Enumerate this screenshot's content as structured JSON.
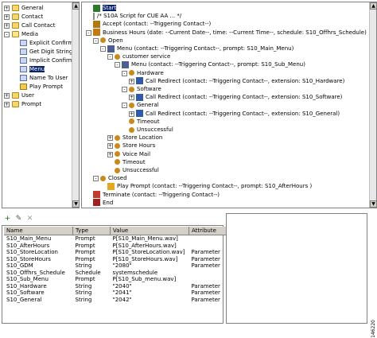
{
  "palette": {
    "tree": [
      {
        "label": "General",
        "icon": "folder-icon",
        "indent": 0,
        "expander": "+"
      },
      {
        "label": "Contact",
        "icon": "folder-icon",
        "indent": 0,
        "expander": "+"
      },
      {
        "label": "Call Contact",
        "icon": "folder-icon",
        "indent": 0,
        "expander": "+"
      },
      {
        "label": "Media",
        "icon": "folder-open-icon",
        "indent": 0,
        "expander": "-"
      },
      {
        "label": "Explicit Confirmation",
        "icon": "step-icon",
        "indent": 1
      },
      {
        "label": "Get Digit String",
        "icon": "step-icon",
        "indent": 1
      },
      {
        "label": "Implicit Confirmation",
        "icon": "step-icon",
        "indent": 1
      },
      {
        "label": "Menu",
        "icon": "menu-step-icon",
        "indent": 1,
        "selected": true
      },
      {
        "label": "Name To User",
        "icon": "step-icon",
        "indent": 1
      },
      {
        "label": "Play Prompt",
        "icon": "speaker-icon",
        "indent": 1
      },
      {
        "label": "User",
        "icon": "folder-icon",
        "indent": 0,
        "expander": "+"
      },
      {
        "label": "Prompt",
        "icon": "folder-icon",
        "indent": 0,
        "expander": "+"
      }
    ]
  },
  "script": {
    "lines": [
      {
        "text": "Start",
        "indent": 0,
        "icon": "start-icon",
        "selected": true
      },
      {
        "text": "/* S10A Script for CUE AA ... */",
        "indent": 0,
        "icon": "comment-icon"
      },
      {
        "text": "Accept (contact: --Triggering Contact--)",
        "indent": 0,
        "icon": "accept-icon"
      },
      {
        "text": "Business Hours (date: --Current Date--, time: --Current Time--, schedule: S10_Offhrs_Schedule)",
        "indent": 0,
        "icon": "clock-icon",
        "expander": "-"
      },
      {
        "text": "Open",
        "indent": 1,
        "icon": "branch-icon",
        "expander": "-"
      },
      {
        "text": "Menu (contact: --Triggering Contact--, prompt: S10_Main_Menu)",
        "indent": 2,
        "icon": "menu-icon",
        "expander": "-"
      },
      {
        "text": "customer service",
        "indent": 3,
        "icon": "branch-icon",
        "expander": "-"
      },
      {
        "text": "Menu (contact: --Triggering Contact--, prompt: S10_Sub_Menu)",
        "indent": 4,
        "icon": "menu-icon",
        "expander": "-"
      },
      {
        "text": "Hardware",
        "indent": 5,
        "icon": "branch-icon",
        "expander": "-"
      },
      {
        "text": "Call Redirect (contact: --Triggering Contact--, extension: S10_Hardware)",
        "indent": 6,
        "icon": "redirect-icon",
        "expander": "+"
      },
      {
        "text": "Software",
        "indent": 5,
        "icon": "branch-icon",
        "expander": "-"
      },
      {
        "text": "Call Redirect (contact: --Triggering Contact--, extension: S10_Software)",
        "indent": 6,
        "icon": "redirect-icon",
        "expander": "+"
      },
      {
        "text": "General",
        "indent": 5,
        "icon": "branch-icon",
        "expander": "-"
      },
      {
        "text": "Call Redirect (contact: --Triggering Contact--, extension: S10_General)",
        "indent": 6,
        "icon": "redirect-icon",
        "expander": "+"
      },
      {
        "text": "Timeout",
        "indent": 5,
        "icon": "branch-icon"
      },
      {
        "text": "Unsuccessful",
        "indent": 5,
        "icon": "branch-icon"
      },
      {
        "text": "Store Location",
        "indent": 3,
        "icon": "branch-icon",
        "expander": "+"
      },
      {
        "text": "Store Hours",
        "indent": 3,
        "icon": "branch-icon",
        "expander": "+"
      },
      {
        "text": "Voice Mail",
        "indent": 3,
        "icon": "branch-icon",
        "expander": "+"
      },
      {
        "text": "Timeout",
        "indent": 3,
        "icon": "branch-icon"
      },
      {
        "text": "Unsuccessful",
        "indent": 3,
        "icon": "branch-icon"
      },
      {
        "text": "Closed",
        "indent": 1,
        "icon": "branch-icon",
        "expander": "-"
      },
      {
        "text": "Play Prompt (contact: --Triggering Contact--, prompt: S10_AfterHours )",
        "indent": 2,
        "icon": "speaker-icon"
      },
      {
        "text": "Terminate (contact: --Triggering Contact--)",
        "indent": 0,
        "icon": "terminate-icon"
      },
      {
        "text": "End",
        "indent": 0,
        "icon": "end-icon"
      }
    ]
  },
  "variables": {
    "toolbar": {
      "add": "+",
      "edit": "✎",
      "delete": "✕"
    },
    "columns": [
      "Name",
      "Type",
      "Value",
      "Attribute"
    ],
    "rows": [
      [
        "S10_Main_Menu",
        "Prompt",
        "P[S10_Main_Menu.wav]",
        ""
      ],
      [
        "S10_AfterHours",
        "Prompt",
        "P[S10_AfterHours.wav]",
        ""
      ],
      [
        "S10_StoreLocation",
        "Prompt",
        "P[S10_StoreLocation.wav]",
        "Parameter"
      ],
      [
        "S10_StoreHours",
        "Prompt",
        "P[S10_StoreHours.wav]",
        "Parameter"
      ],
      [
        "S10_GDM",
        "String",
        "\"2080\"",
        "Parameter"
      ],
      [
        "S10_Offhrs_Schedule",
        "Schedule",
        "systemschedule",
        ""
      ],
      [
        "S10_Sub_Menu",
        "Prompt",
        "P[S10_Sub_menu.wav]",
        ""
      ],
      [
        "S10_Hardware",
        "String",
        "\"2040\"",
        "Parameter"
      ],
      [
        "S10_Software",
        "String",
        "\"2041\"",
        "Parameter"
      ],
      [
        "S10_General",
        "String",
        "\"2042\"",
        "Parameter"
      ]
    ]
  },
  "figure_id": "146220"
}
